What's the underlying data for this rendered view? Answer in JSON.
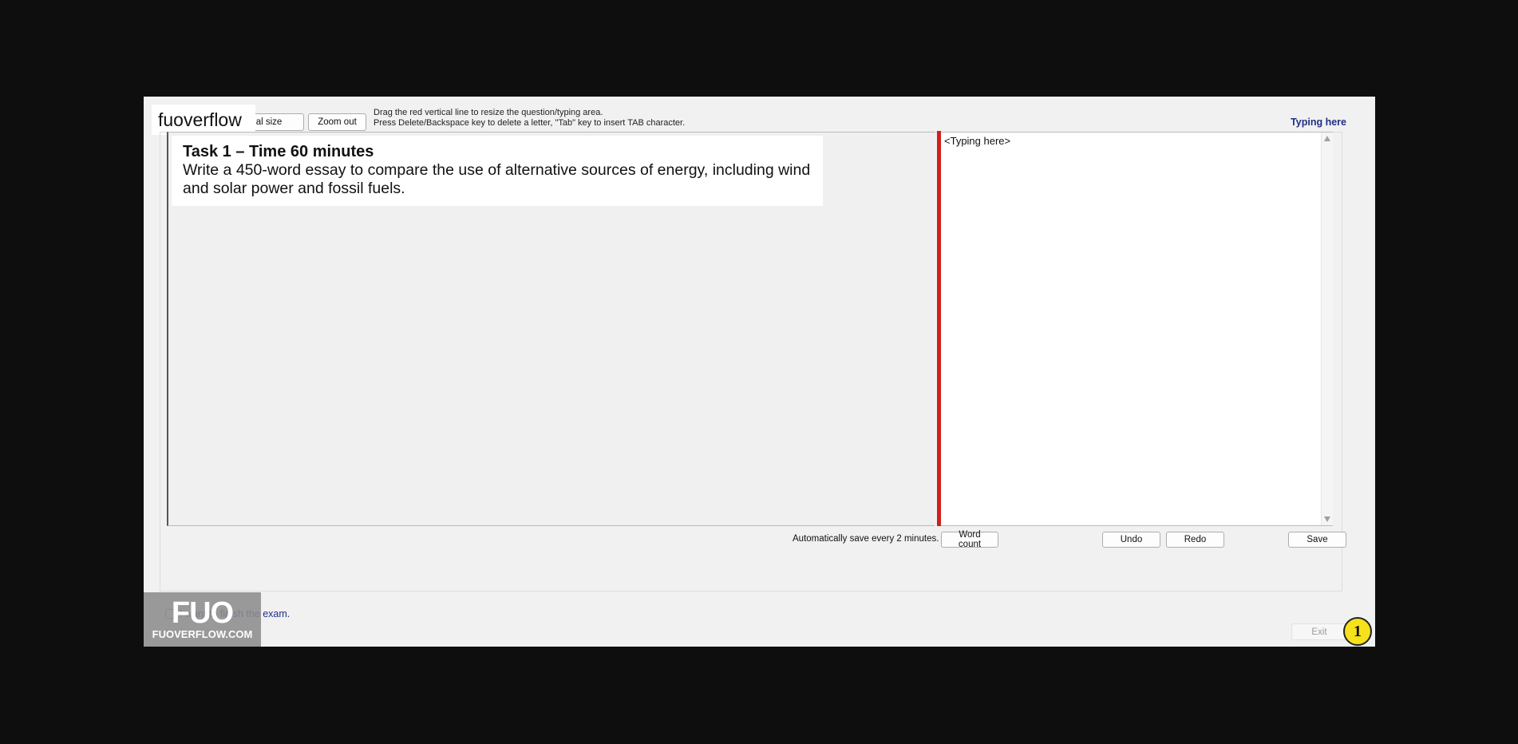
{
  "watermark_logo": {
    "label": "fuoverflow"
  },
  "toolbar": {
    "original_size_label": "al size",
    "zoom_out_label": "Zoom out",
    "instructions": [
      "Drag the red vertical line to resize the question/typing area.",
      "Press Delete/Backspace key to delete a letter, \"Tab\" key to insert TAB character."
    ],
    "typing_here_label": "Typing here"
  },
  "question": {
    "title": "Task 1 – Time 60 minutes",
    "body": "Write a 450-word essay to compare the use of alternative sources of energy, including wind and solar power and fossil fuels."
  },
  "editor": {
    "placeholder": "<Typing here>",
    "divider_color": "#d0201a"
  },
  "actions": {
    "autosave_text": "Automatically save every 2 minutes.",
    "word_count_label": "Word count",
    "undo_label": "Undo",
    "redo_label": "Redo",
    "save_label": "Save"
  },
  "footer": {
    "finish_checkbox_label": "I want to finish the exam.",
    "exit_label": "Exit",
    "badge_mark": "FUO",
    "badge_domain": "FUOVERFLOW.COM"
  },
  "step_marker": {
    "number": "1",
    "color": "#f5e21a"
  }
}
